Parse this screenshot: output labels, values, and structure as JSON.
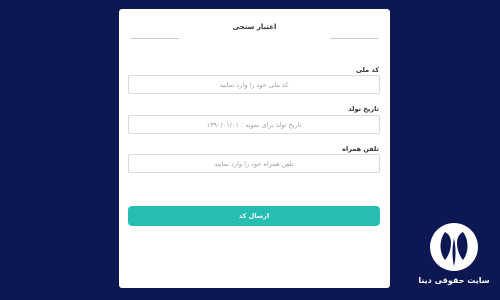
{
  "form": {
    "title": "اعتبار سنجی",
    "fields": [
      {
        "label": "کد ملی",
        "placeholder": "کد ملی خود را وارد نمایید",
        "value": ""
      },
      {
        "label": "تاریخ تولد",
        "placeholder": "تاریخ تولد برای نمونه : ۱۳۹۰/۰۱/۰۱",
        "value": ""
      },
      {
        "label": "تلفن همراه",
        "placeholder": "تلفن همراه خود را وارد نمایید",
        "value": ""
      }
    ],
    "submit_label": "ارسال کد"
  },
  "watermark": {
    "text": "سایت حقوقی دینا",
    "icon": "dina-logo-icon"
  },
  "colors": {
    "background": "#0d1752",
    "card": "#ffffff",
    "accent": "#26bdb2",
    "logo_circle": "#ffffff",
    "logo_mark": "#0d1752"
  }
}
